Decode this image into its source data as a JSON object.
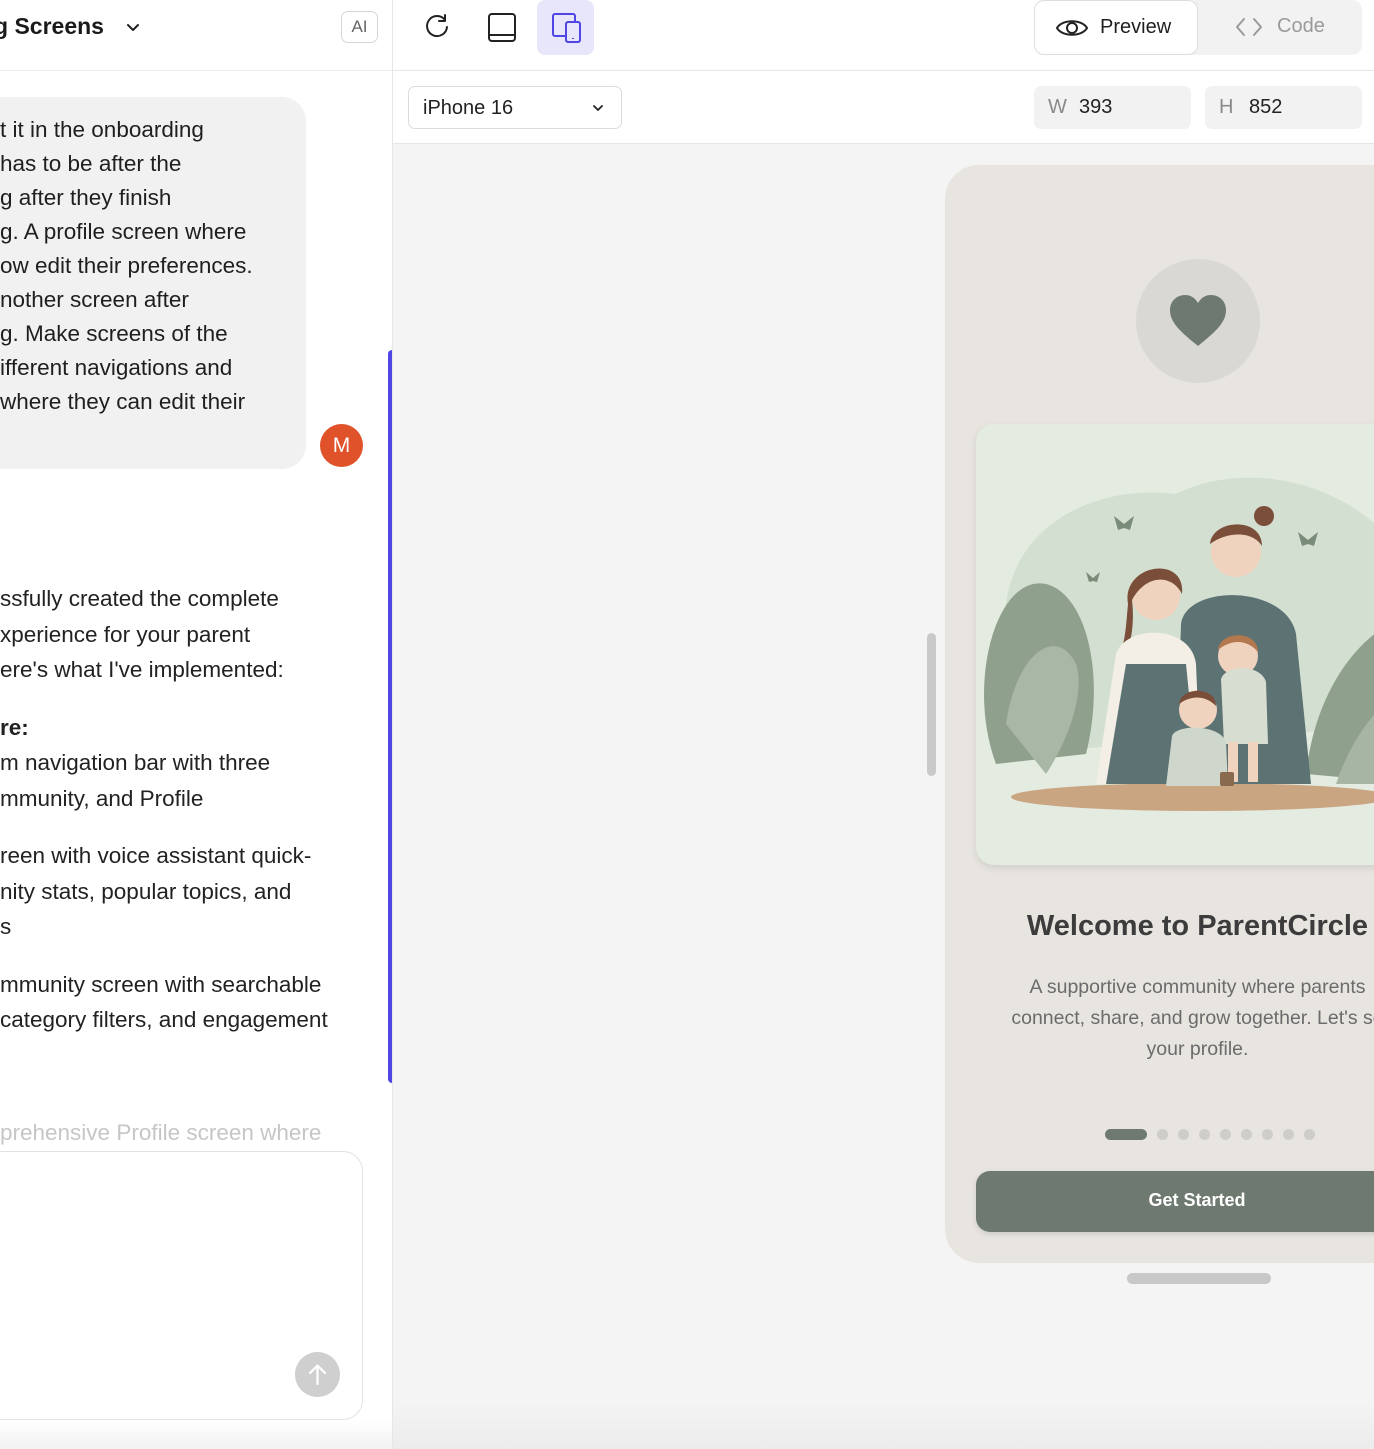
{
  "project": {
    "title": "g Screens",
    "ai_badge": "AI"
  },
  "chat": {
    "user_message_lines": [
      "t it in the onboarding",
      "has to be after the",
      "g after they finish",
      "g. A profile screen where",
      "ow edit their preferences.",
      "nother screen after",
      "g. Make screens of the",
      "ifferent navigations and",
      " where they can edit their"
    ],
    "avatar_initial": "M",
    "assistant_lines": [
      "ssfully created the complete",
      "xperience for your parent",
      "ere's what I've implemented:"
    ],
    "assistant_heading": "re:",
    "assistant_bullets": [
      [
        "m navigation bar with three",
        "mmunity, and Profile"
      ],
      [
        "reen with voice assistant quick-",
        "nity stats, popular topics, and",
        "s"
      ],
      [
        "mmunity screen with searchable",
        "category filters, and engagement"
      ]
    ],
    "faded_line": "prehensive Profile screen where"
  },
  "toolbar": {
    "preview_label": "Preview",
    "code_label": "Code"
  },
  "device": {
    "name": "iPhone 16",
    "width_key": "W",
    "width": "393",
    "height_key": "H",
    "height": "852"
  },
  "phone": {
    "title": "Welcome to ParentCircle",
    "description_lines": [
      "A supportive community where parents",
      "connect, share, and grow together. Let's se",
      "your profile."
    ],
    "page_count": 9,
    "active_page": 1,
    "cta_label": "Get Started",
    "accent": "#6e7a70"
  }
}
